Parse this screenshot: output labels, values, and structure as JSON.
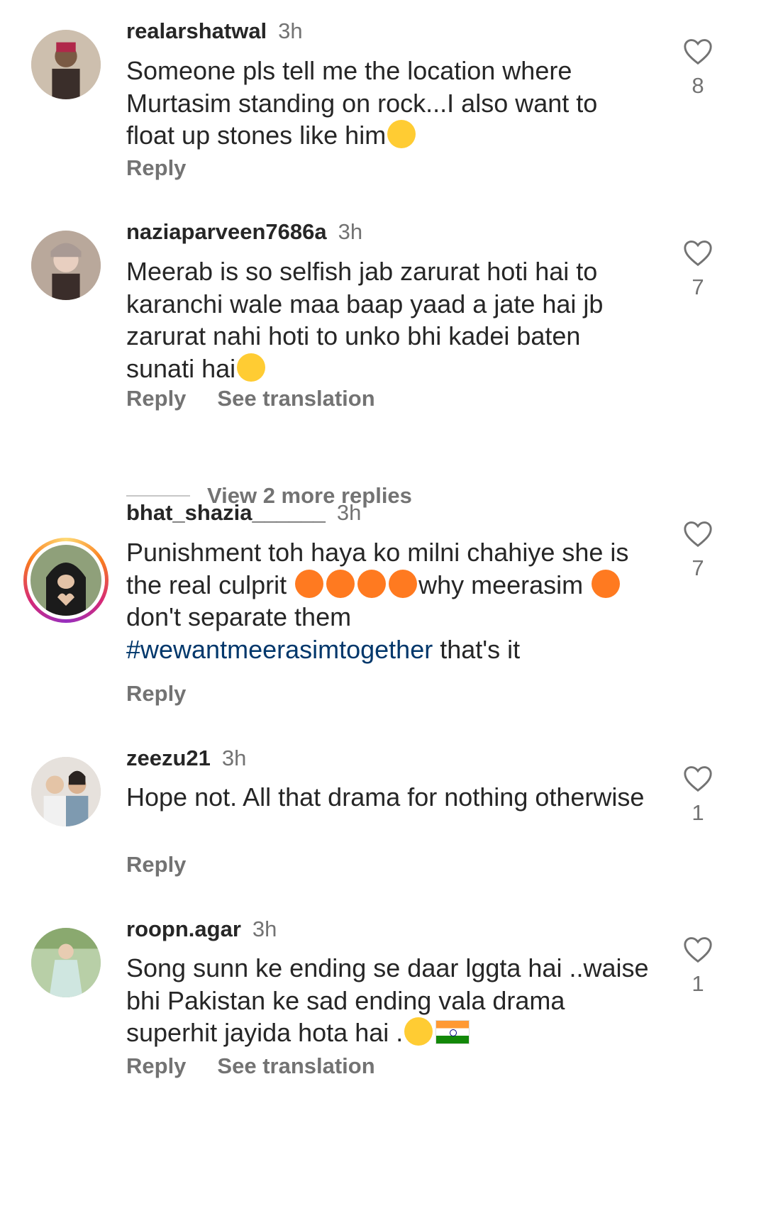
{
  "comments": [
    {
      "username": "realarshatwal",
      "time": "3h",
      "text": "Someone pls tell me the location where Murtasim standing on rock...I also want to float up stones like him",
      "emoji": "laughing-tears",
      "likes": "8",
      "reply": "Reply"
    },
    {
      "username": "naziaparveen7686a",
      "time": "3h",
      "text": "Meerab is so selfish jab zarurat hoti hai to karanchi wale maa baap yaad a jate hai jb zarurat nahi hoti to unko bhi kadei baten sunati hai",
      "emoji": "expressionless",
      "likes": "7",
      "reply": "Reply",
      "translate": "See translation"
    },
    {
      "username": "bhat_shazia______",
      "time": "3h",
      "text_a": "Punishment toh haya ko milni chahiye she is the real culprit ",
      "text_b": "why meerasim ",
      "text_c": " don't separate them ",
      "hashtag": "#wewantmeerasimtogether",
      "text_d": " that's it",
      "likes": "7",
      "reply": "Reply"
    },
    {
      "username": "zeezu21",
      "time": "3h",
      "text": "Hope not. All that drama for nothing otherwise",
      "likes": "1",
      "reply": "Reply"
    },
    {
      "username": "roopn.agar",
      "time": "3h",
      "text": "Song sunn ke ending se daar lggta hai ..waise bhi Pakistan ke sad ending vala drama superhit jayida hota hai .",
      "emoji": "disappointed",
      "flag": "india-flag",
      "likes": "1",
      "reply": "Reply",
      "translate": "See translation"
    }
  ],
  "view_more_replies": "View 2 more replies",
  "colors": {
    "text": "#262626",
    "secondary": "#737373",
    "hashtag": "#00376b",
    "divider": "#c7c7c7"
  }
}
